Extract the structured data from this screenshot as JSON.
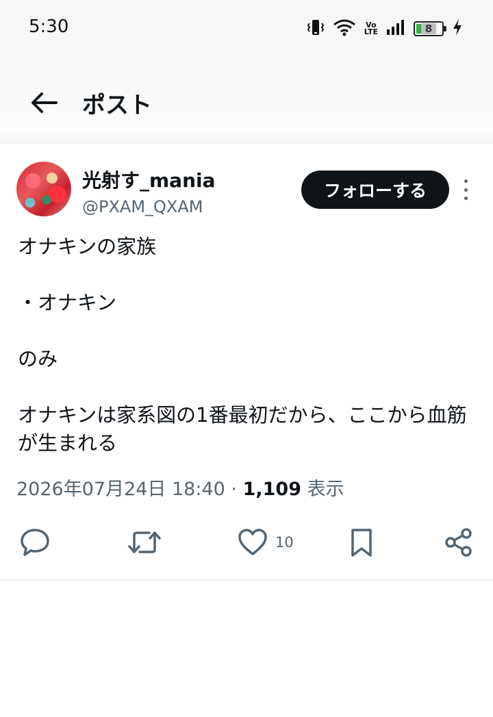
{
  "status_bar": {
    "time": "5:30",
    "volte_top": "Vo",
    "volte_bottom": "LTE",
    "battery_level": "8",
    "icons": [
      "vibrate-icon",
      "wifi-icon",
      "volte-icon",
      "signal-icon",
      "battery-icon",
      "charging-icon"
    ]
  },
  "header": {
    "back_icon": "back-arrow-icon",
    "title": "ポスト"
  },
  "post": {
    "author": {
      "display_name": "光射す_mania",
      "handle": "@PXAM_QXAM"
    },
    "follow_label": "フォローする",
    "more_icon": "more-vertical-icon",
    "text_lines": [
      "オナキンの家族",
      "",
      "・オナキン",
      "",
      "のみ",
      "",
      "オナキンは家系図の1番最初だから、ここから血筋が生まれる"
    ],
    "timestamp": "2026年07月24日 18:40",
    "separator": " · ",
    "views_count": "1,109",
    "views_label": " 表示",
    "actions": {
      "reply_icon": "reply-icon",
      "repost_icon": "repost-icon",
      "like_icon": "heart-icon",
      "like_count": "10",
      "bookmark_icon": "bookmark-icon",
      "share_icon": "share-icon"
    }
  },
  "colors": {
    "text_primary": "#0f1419",
    "text_secondary": "#536471",
    "follow_button_bg": "#0f1419",
    "divider": "#e7e9ea",
    "battery_fill": "#2db33d"
  }
}
